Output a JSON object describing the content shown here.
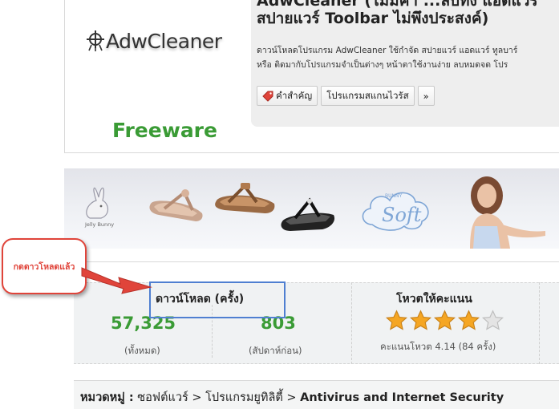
{
  "product": {
    "name": "AdwCleaner",
    "title_line1": "AdwCleaner (ไม่มีคำ ...ลบทิ้ง แอดแวร์",
    "title_line2": "สปายแวร์ Toolbar ไม่พึงประสงค์)",
    "desc_line1": "ดาวน์โหลดโปรแกรม AdwCleaner ใช้กำจัด สปายแวร์ แอดแวร์ ทูลบาร์",
    "desc_line2": "หรือ ติดมากับโปรแกรมจำเป็นต่างๆ หน้าตาใช้งานง่าย ลบหมดจด โปร",
    "license": "Freeware",
    "tags": [
      "คำสำคัญ",
      "โปรแกรมสแกนไวรัส",
      "»"
    ]
  },
  "callout": {
    "text": "กดดาวโหลดแล้ว"
  },
  "stats": {
    "downloads": {
      "header": "ดาวน์โหลด (ครั้ง)",
      "total": "57,325",
      "total_label": "(ทั้งหมด)",
      "week": "803",
      "week_label": "(สัปดาห์ก่อน)"
    },
    "rating": {
      "header": "โหวตให้คะแนน",
      "stars": 4,
      "max_stars": 5,
      "label": "คะแนนโหวต 4.14 (84 ครั้ง)"
    }
  },
  "breadcrumb": {
    "prefix": "หมวดหมู่ :",
    "items": [
      "ซอฟต์แวร์",
      "โปรแกรมยูทิลิตี้",
      "Antivirus and Internet Security"
    ],
    "separator": ">"
  },
  "colors": {
    "accent_green": "#3a9b35",
    "callout_red": "#e0443a",
    "highlight_blue": "#4f7fd1",
    "star_gold": "#f5a623"
  },
  "banner": {
    "brand": "Soft",
    "sub_brand": "BUNNY",
    "left_brand": "Jelly Bunny"
  }
}
